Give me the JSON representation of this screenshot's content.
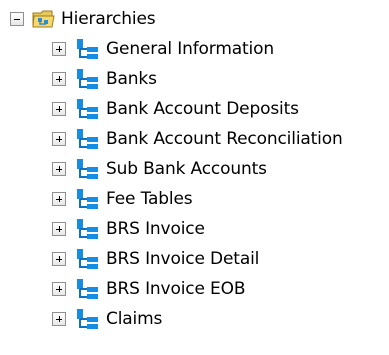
{
  "tree": {
    "root": {
      "label": "Hierarchies",
      "expander_state": "collapse",
      "icon": "folder-icon"
    },
    "items": [
      {
        "label": "General Information",
        "expander_state": "expand",
        "icon": "hierarchy-icon"
      },
      {
        "label": "Banks",
        "expander_state": "expand",
        "icon": "hierarchy-icon"
      },
      {
        "label": "Bank Account Deposits",
        "expander_state": "expand",
        "icon": "hierarchy-icon"
      },
      {
        "label": "Bank Account Reconciliation",
        "expander_state": "expand",
        "icon": "hierarchy-icon"
      },
      {
        "label": "Sub Bank Accounts",
        "expander_state": "expand",
        "icon": "hierarchy-icon"
      },
      {
        "label": "Fee Tables",
        "expander_state": "expand",
        "icon": "hierarchy-icon"
      },
      {
        "label": "BRS Invoice",
        "expander_state": "expand",
        "icon": "hierarchy-icon"
      },
      {
        "label": "BRS Invoice Detail",
        "expander_state": "expand",
        "icon": "hierarchy-icon"
      },
      {
        "label": "BRS Invoice EOB",
        "expander_state": "expand",
        "icon": "hierarchy-icon"
      },
      {
        "label": "Claims",
        "expander_state": "expand",
        "icon": "hierarchy-icon"
      }
    ]
  }
}
